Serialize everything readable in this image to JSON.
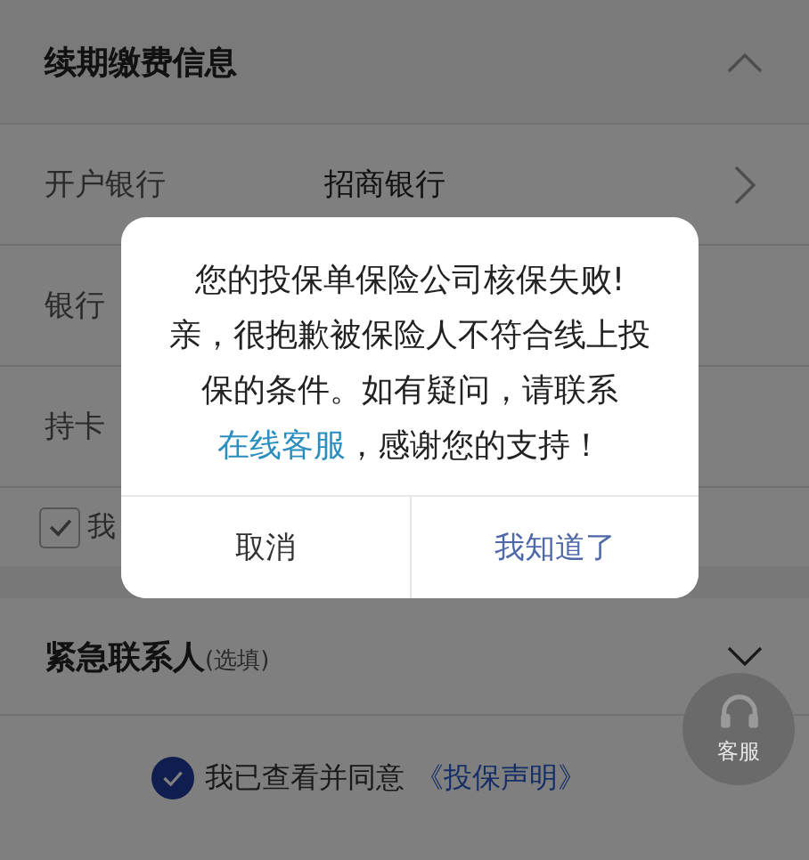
{
  "renewal_section": {
    "title": "续期缴费信息",
    "expanded": true
  },
  "rows": [
    {
      "label": "开户银行",
      "value": "招商银行",
      "kind": "select"
    },
    {
      "label": "银行",
      "kind": "field"
    },
    {
      "label": "持卡",
      "kind": "field"
    }
  ],
  "confirm_row": {
    "label": "我",
    "checked": true
  },
  "contact_section": {
    "title": "紧急联系人",
    "hint": "(选填)",
    "expanded": false
  },
  "agreement": {
    "text": "我已查看并同意",
    "link": "《投保声明》",
    "checked": true
  },
  "service_button": {
    "label": "客服"
  },
  "dialog": {
    "text_before": "您的投保单保险公司核保失败!亲，很抱歉被保险人不符合线上投保的条件。如有疑问，请联系",
    "link": "在线客服",
    "text_after": "，感谢您的支持！",
    "buttons": [
      {
        "label": "取消",
        "kind": "cancel"
      },
      {
        "label": "我知道了",
        "kind": "primary"
      }
    ]
  }
}
